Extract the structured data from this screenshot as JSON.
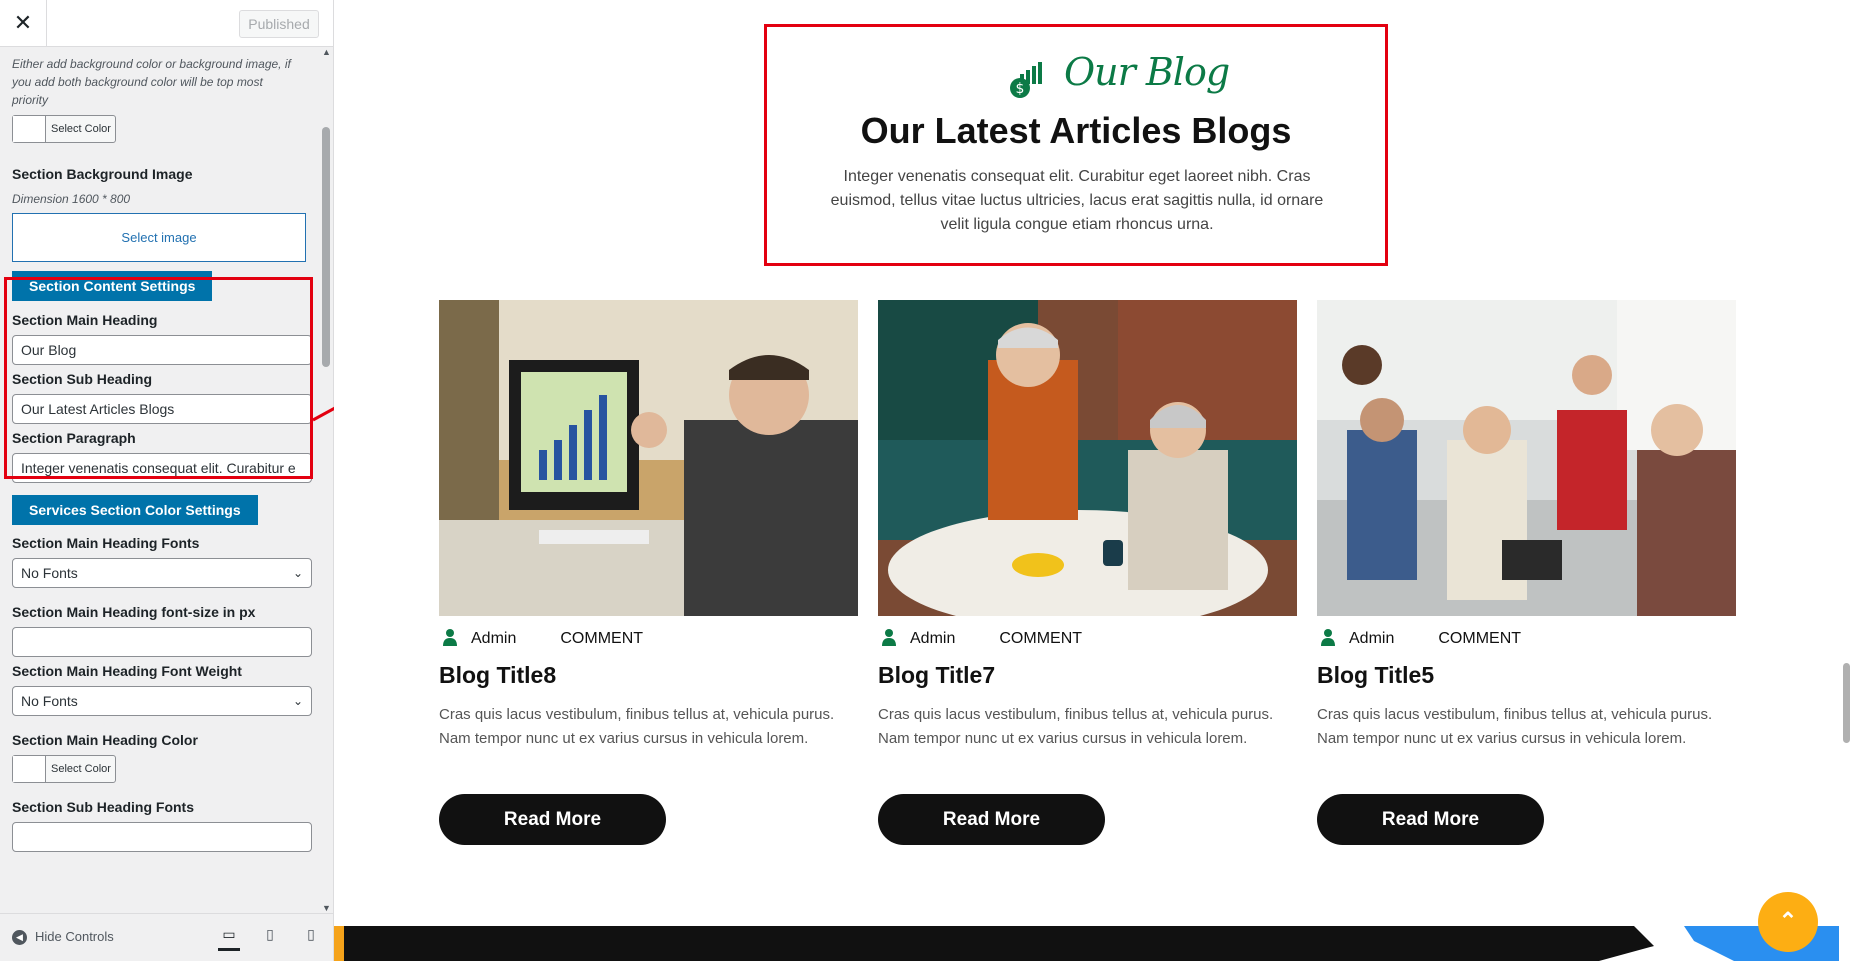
{
  "panel": {
    "close_label": "✕",
    "publish_label": "Published",
    "bg_desc": "Either add background color or background image, if you add both background color will be top most priority",
    "select_color": "Select Color",
    "bg_image_label": "Section Background Image",
    "bg_image_dim": "Dimension 1600 * 800",
    "select_image": "Select image",
    "content_settings_btn": "Section Content Settings",
    "main_heading_label": "Section Main Heading",
    "main_heading_value": "Our Blog",
    "sub_heading_label": "Section Sub Heading",
    "sub_heading_value": "Our Latest Articles Blogs",
    "paragraph_label": "Section Paragraph",
    "paragraph_value": "Integer venenatis consequat elit. Curabitur e",
    "color_settings_btn": "Services Section Color Settings",
    "main_heading_fonts_label": "Section Main Heading Fonts",
    "main_heading_fonts_value": "No Fonts",
    "main_heading_fontsize_label": "Section Main Heading font-size in px",
    "main_heading_fontsize_value": "",
    "main_heading_weight_label": "Section Main Heading Font Weight",
    "main_heading_weight_value": "No Fonts",
    "main_heading_color_label": "Section Main Heading Color",
    "sub_heading_fonts_label": "Section Sub Heading Fonts",
    "hide_controls": "Hide Controls"
  },
  "preview": {
    "kicker": "Our Blog",
    "heading": "Our Latest Articles Blogs",
    "paragraph": "Integer venenatis consequat elit. Curabitur eget laoreet nibh. Cras euismod, tellus vitae luctus ultricies, lacus erat sagittis nulla, id ornare velit ligula congue etiam rhoncus urna.",
    "cards": [
      {
        "author": "Admin",
        "comment": "COMMENT",
        "title": "Blog Title8",
        "desc": "Cras quis lacus vestibulum, finibus tellus at, vehicula purus. Nam tempor nunc ut ex varius cursus in vehicula lorem.",
        "button": "Read More"
      },
      {
        "author": "Admin",
        "comment": "COMMENT",
        "title": "Blog Title7",
        "desc": "Cras quis lacus vestibulum, finibus tellus at, vehicula purus. Nam tempor nunc ut ex varius cursus in vehicula lorem.",
        "button": "Read More"
      },
      {
        "author": "Admin",
        "comment": "COMMENT",
        "title": "Blog Title5",
        "desc": "Cras quis lacus vestibulum, finibus tellus at, vehicula purus. Nam tempor nunc ut ex varius cursus in vehicula lorem.",
        "button": "Read More"
      }
    ]
  },
  "colors": {
    "accent_green": "#0c7a46",
    "highlight_red": "#e30010",
    "wp_blue": "#0073aa",
    "top_button": "#fdae13"
  }
}
